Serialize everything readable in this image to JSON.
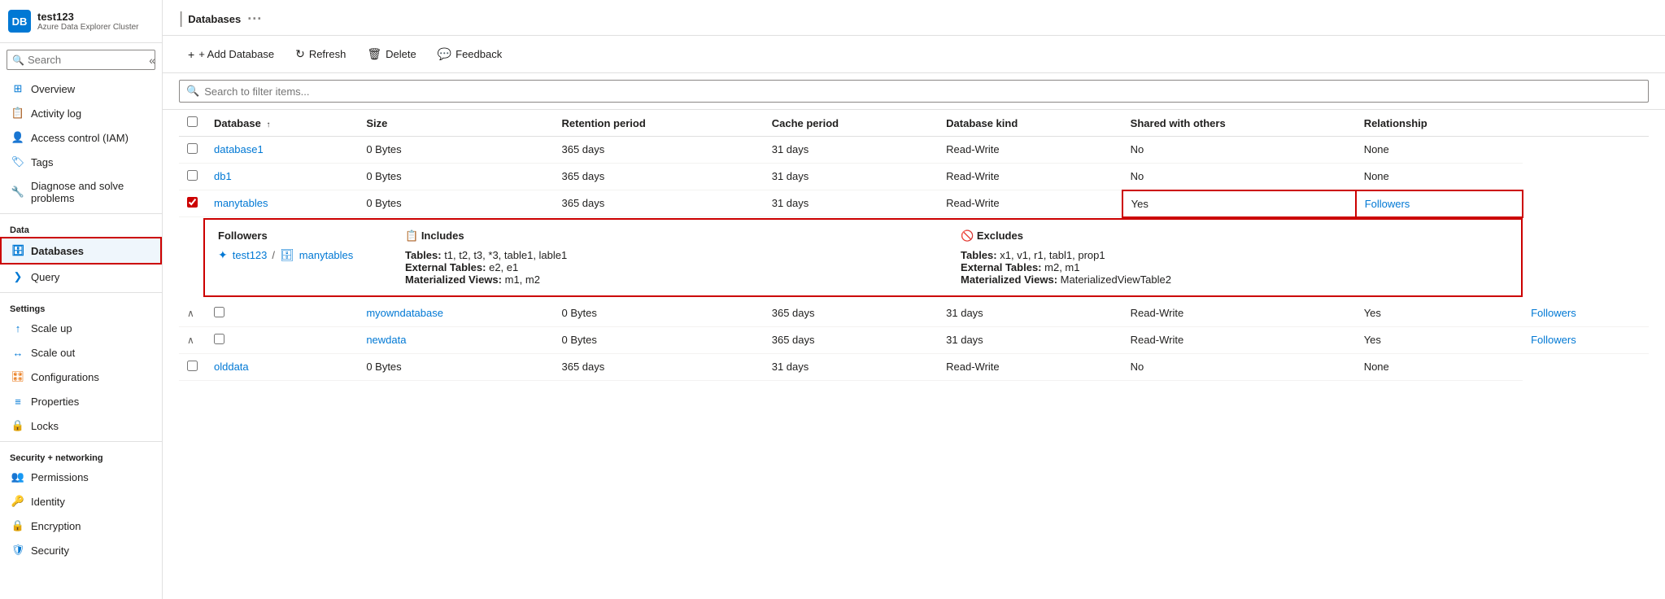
{
  "sidebar": {
    "logo_text": "DB",
    "cluster_name": "test123",
    "cluster_subtitle": "Azure Data Explorer Cluster",
    "search_placeholder": "Search",
    "collapse_icon": "«",
    "nav_items": [
      {
        "id": "overview",
        "label": "Overview",
        "icon": "⊞"
      },
      {
        "id": "activity-log",
        "label": "Activity log",
        "icon": "📋"
      },
      {
        "id": "access-control",
        "label": "Access control (IAM)",
        "icon": "👤"
      },
      {
        "id": "tags",
        "label": "Tags",
        "icon": "🏷"
      },
      {
        "id": "diagnose",
        "label": "Diagnose and solve problems",
        "icon": "🔧"
      }
    ],
    "data_section": "Data",
    "data_items": [
      {
        "id": "databases",
        "label": "Databases",
        "icon": "🗄",
        "active": true
      },
      {
        "id": "query",
        "label": "Query",
        "icon": "❯"
      }
    ],
    "settings_section": "Settings",
    "settings_items": [
      {
        "id": "scale-up",
        "label": "Scale up",
        "icon": "↑"
      },
      {
        "id": "scale-out",
        "label": "Scale out",
        "icon": "↔"
      },
      {
        "id": "configurations",
        "label": "Configurations",
        "icon": "⚙"
      },
      {
        "id": "properties",
        "label": "Properties",
        "icon": "≡"
      },
      {
        "id": "locks",
        "label": "Locks",
        "icon": "🔒"
      }
    ],
    "security_section": "Security + networking",
    "security_items": [
      {
        "id": "permissions",
        "label": "Permissions",
        "icon": "👥"
      },
      {
        "id": "identity",
        "label": "Identity",
        "icon": "🪪"
      },
      {
        "id": "encryption",
        "label": "Encryption",
        "icon": "🔒"
      },
      {
        "id": "security",
        "label": "Security",
        "icon": "🛡"
      }
    ]
  },
  "page": {
    "title": "Databases",
    "dots": "···"
  },
  "toolbar": {
    "add_button": "+ Add Database",
    "refresh_button": "Refresh",
    "delete_button": "Delete",
    "feedback_button": "Feedback"
  },
  "search": {
    "placeholder": "Search to filter items..."
  },
  "table": {
    "columns": [
      {
        "id": "database",
        "label": "Database",
        "sort": "↑"
      },
      {
        "id": "size",
        "label": "Size"
      },
      {
        "id": "retention",
        "label": "Retention period"
      },
      {
        "id": "cache",
        "label": "Cache period"
      },
      {
        "id": "kind",
        "label": "Database kind"
      },
      {
        "id": "shared",
        "label": "Shared with others"
      },
      {
        "id": "relationship",
        "label": "Relationship"
      }
    ],
    "rows": [
      {
        "id": "database1",
        "name": "database1",
        "size": "0 Bytes",
        "retention": "365 days",
        "cache": "31 days",
        "kind": "Read-Write",
        "shared": "No",
        "relationship": "None",
        "expandable": false
      },
      {
        "id": "db1",
        "name": "db1",
        "size": "0 Bytes",
        "retention": "365 days",
        "cache": "31 days",
        "kind": "Read-Write",
        "shared": "No",
        "relationship": "None",
        "expandable": false
      },
      {
        "id": "manytables",
        "name": "manytables",
        "size": "0 Bytes",
        "retention": "365 days",
        "cache": "31 days",
        "kind": "Read-Write",
        "shared": "Yes",
        "relationship": "Followers",
        "expandable": true,
        "expanded": true
      },
      {
        "id": "myowndatabase",
        "name": "myowndatabase",
        "size": "0 Bytes",
        "retention": "365 days",
        "cache": "31 days",
        "kind": "Read-Write",
        "shared": "Yes",
        "relationship": "Followers",
        "expandable": true,
        "expanded": false
      },
      {
        "id": "newdata",
        "name": "newdata",
        "size": "0 Bytes",
        "retention": "365 days",
        "cache": "31 days",
        "kind": "Read-Write",
        "shared": "Yes",
        "relationship": "Followers",
        "expandable": true,
        "expanded": false
      },
      {
        "id": "olddata",
        "name": "olddata",
        "size": "0 Bytes",
        "retention": "365 days",
        "cache": "31 days",
        "kind": "Read-Write",
        "shared": "No",
        "relationship": "None",
        "expandable": false
      }
    ]
  },
  "followers_detail": {
    "section_title": "Followers",
    "includes_title": "Includes",
    "excludes_title": "Excludes",
    "cluster_name": "test123",
    "db_name": "manytables",
    "includes": {
      "tables_label": "Tables:",
      "tables_value": "t1, t2, t3, *3, table1, lable1",
      "external_tables_label": "External Tables:",
      "external_tables_value": "e2, e1",
      "materialized_views_label": "Materialized Views:",
      "materialized_views_value": "m1, m2"
    },
    "excludes": {
      "tables_label": "Tables:",
      "tables_value": "x1, v1, r1, tabl1, prop1",
      "external_tables_label": "External Tables:",
      "external_tables_value": "m2, m1",
      "materialized_views_label": "Materialized Views:",
      "materialized_views_value": "MaterializedViewTable2"
    }
  },
  "colors": {
    "accent": "#0078d4",
    "red": "#c00000",
    "active_bg": "#eff6fc"
  }
}
